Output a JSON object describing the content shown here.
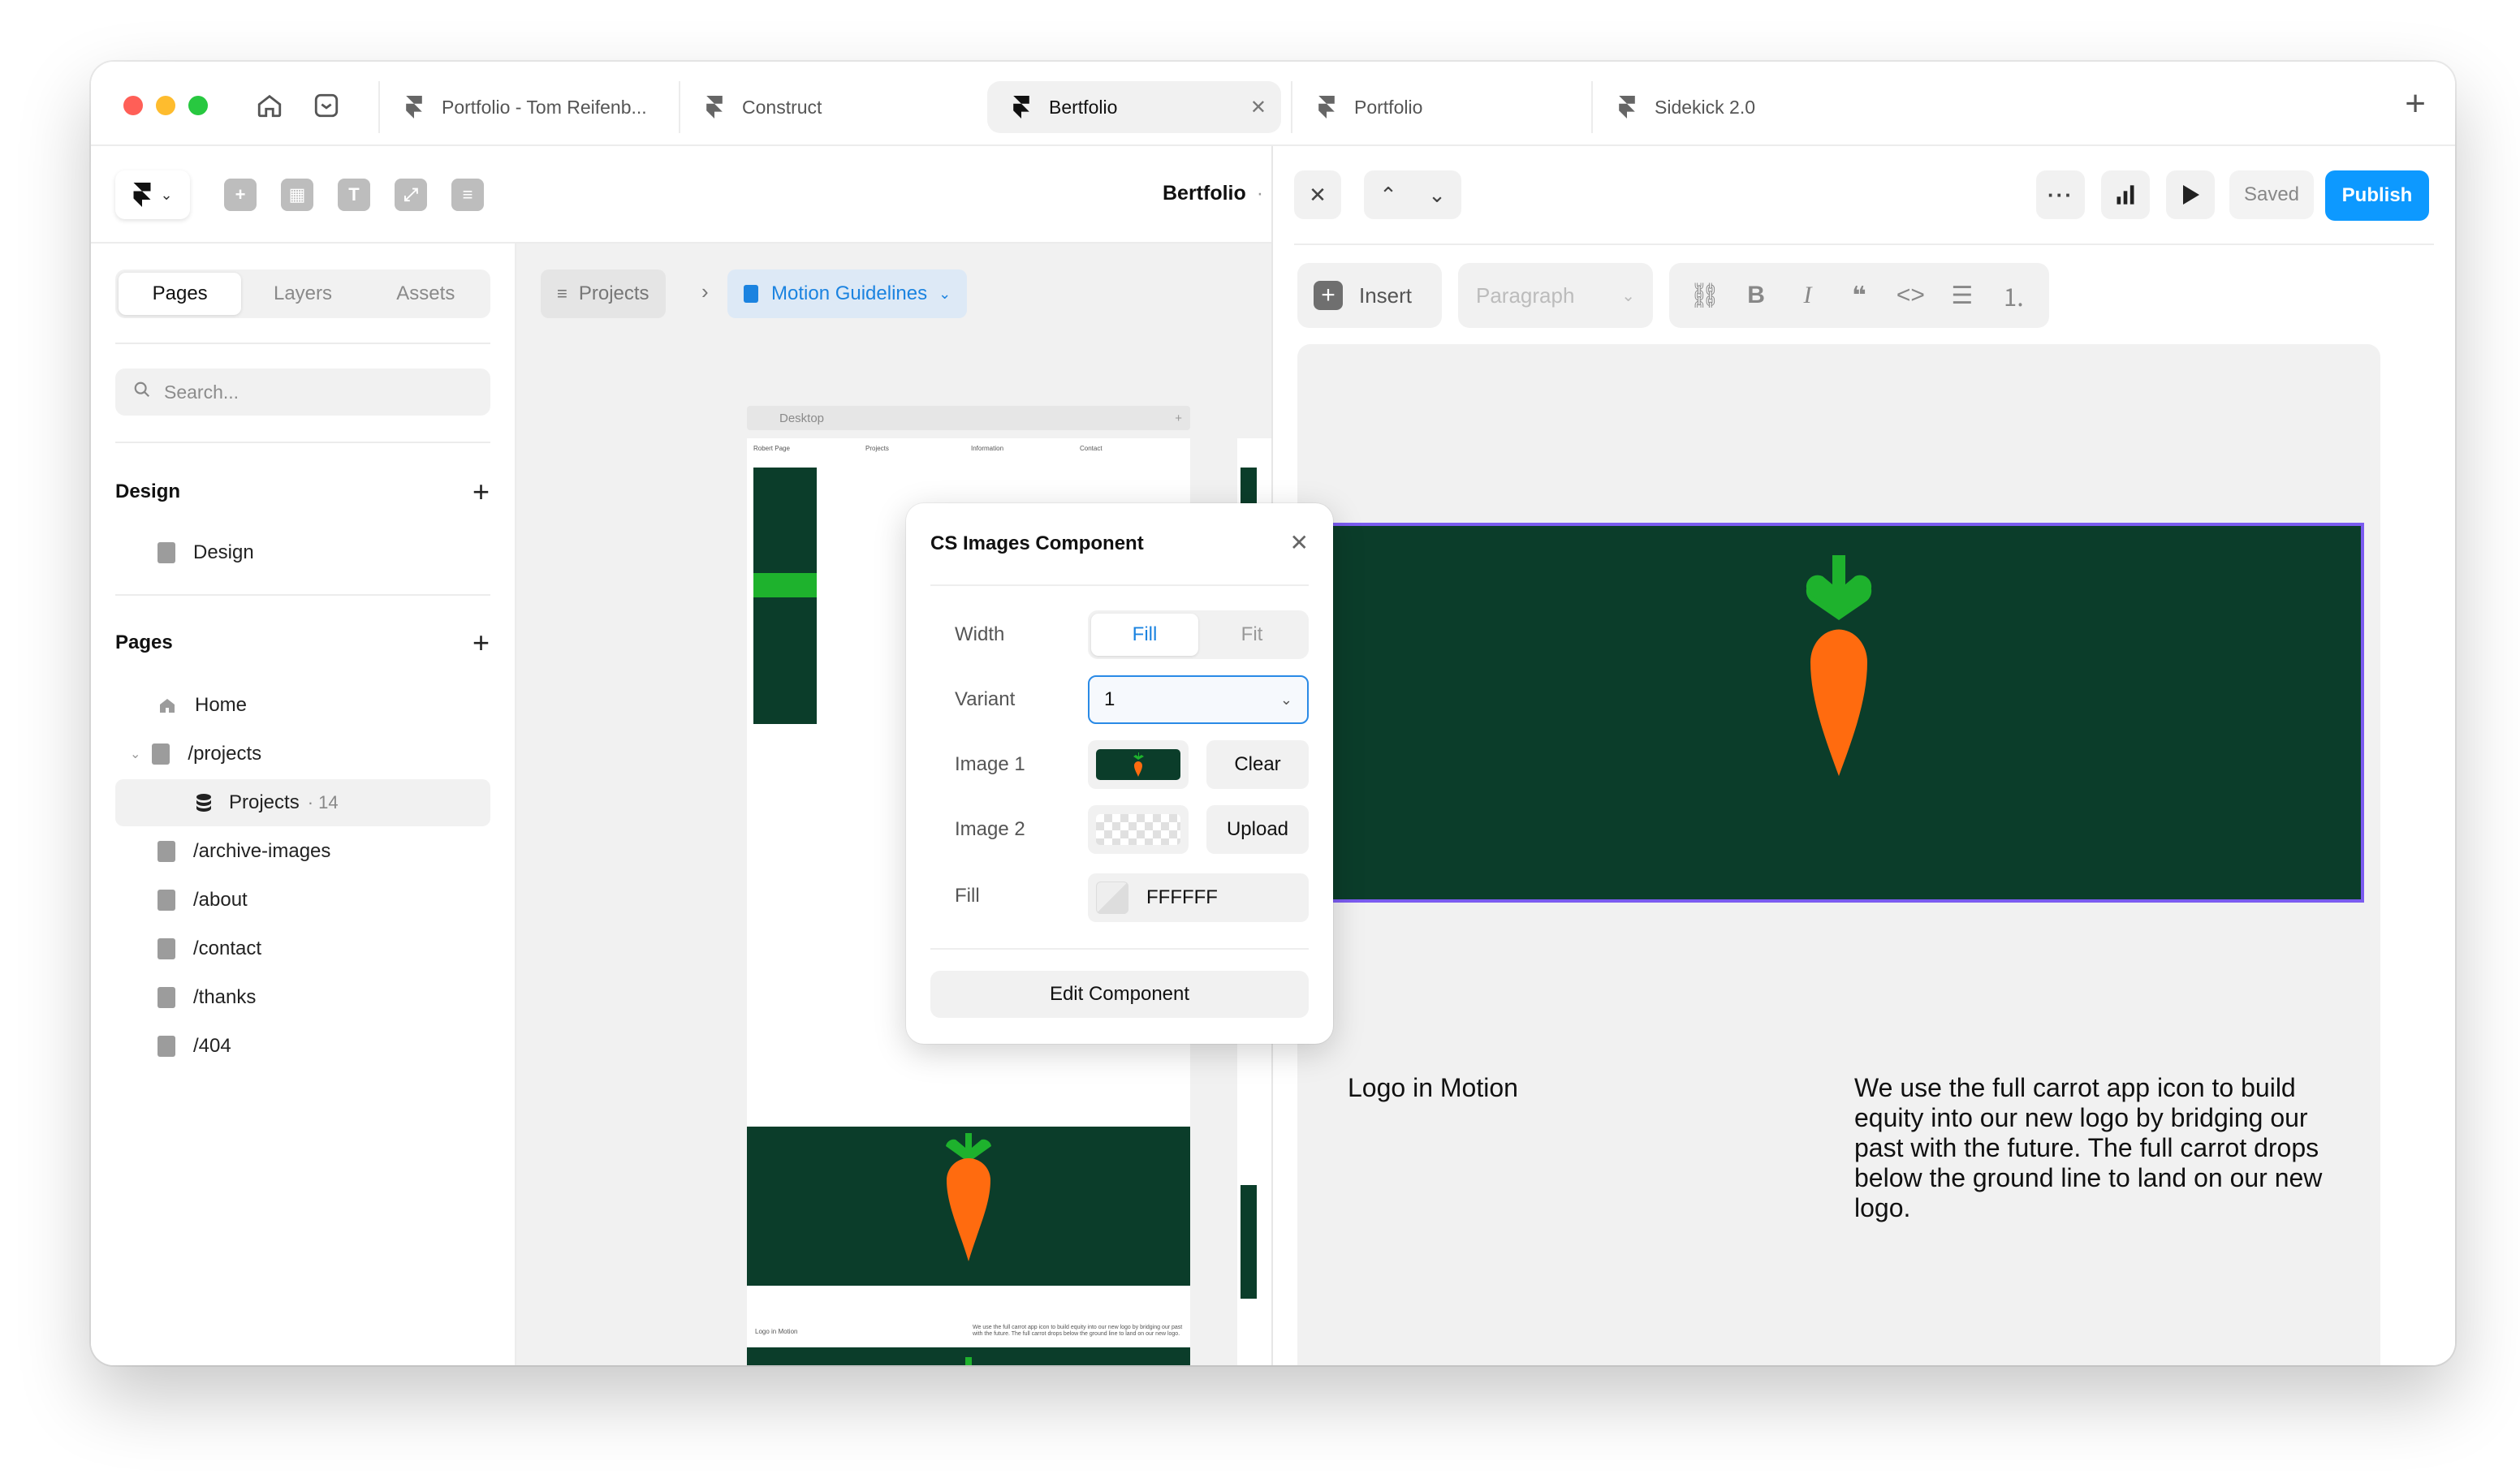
{
  "tabs": [
    {
      "label": "Portfolio - Tom Reifenb...",
      "active": false
    },
    {
      "label": "Construct",
      "active": false
    },
    {
      "label": "Bertfolio",
      "active": true
    },
    {
      "label": "Portfolio",
      "active": false
    },
    {
      "label": "Sidekick 2.0",
      "active": false
    }
  ],
  "editor": {
    "project_title": "Bertfolio",
    "project_title_suffix": "·"
  },
  "sidebar": {
    "segments": [
      "Pages",
      "Layers",
      "Assets"
    ],
    "search_placeholder": "Search...",
    "design_section": "Design",
    "design_items": [
      "Design"
    ],
    "pages_section": "Pages",
    "pages": [
      {
        "label": "Home",
        "icon": "home-icon"
      },
      {
        "label": "/projects",
        "icon": "page-icon"
      },
      {
        "label": "Projects",
        "icon": "database-icon",
        "count": "14"
      },
      {
        "label": "/archive-images",
        "icon": "page-icon"
      },
      {
        "label": "/about",
        "icon": "page-icon"
      },
      {
        "label": "/contact",
        "icon": "page-icon"
      },
      {
        "label": "/thanks",
        "icon": "page-icon"
      },
      {
        "label": "/404",
        "icon": "page-icon"
      }
    ],
    "count_sep": "·"
  },
  "canvas": {
    "breadcrumb_root": "Projects",
    "breadcrumb_current": "Motion Guidelines",
    "frame_label": "Desktop",
    "mini_nav": [
      "Robert Page",
      "Projects",
      "Information",
      "Contact"
    ],
    "mini_caption": "Logo in Motion",
    "mini_body": "We use the full carrot app icon to build equity into our new logo by bridging our past with the future. The full carrot drops below the ground line to land on our new logo."
  },
  "popup": {
    "title": "CS Images Component",
    "width_label": "Width",
    "width_options": [
      "Fill",
      "Fit"
    ],
    "variant_label": "Variant",
    "variant_value": "1",
    "image1_label": "Image 1",
    "image1_action": "Clear",
    "image2_label": "Image 2",
    "image2_action": "Upload",
    "fill_label": "Fill",
    "fill_value": "FFFFFF",
    "edit_button": "Edit Component"
  },
  "cms": {
    "saved_label": "Saved",
    "publish_label": "Publish",
    "insert_label": "Insert",
    "paragraph_placeholder": "Paragraph",
    "caption": "Logo in Motion",
    "body": "We use the full carrot app icon to build equity into our new logo by bridging our past with the future. The full carrot drops below the ground line to land on our new logo."
  },
  "colors": {
    "accent": "#0d99ff",
    "link_blue": "#1b83e0",
    "brand_dark_green": "#0b3d2a",
    "carrot_orange": "#ff6b0f",
    "leaf_green": "#1eb22d",
    "selection_purple": "#7b5cf0"
  }
}
